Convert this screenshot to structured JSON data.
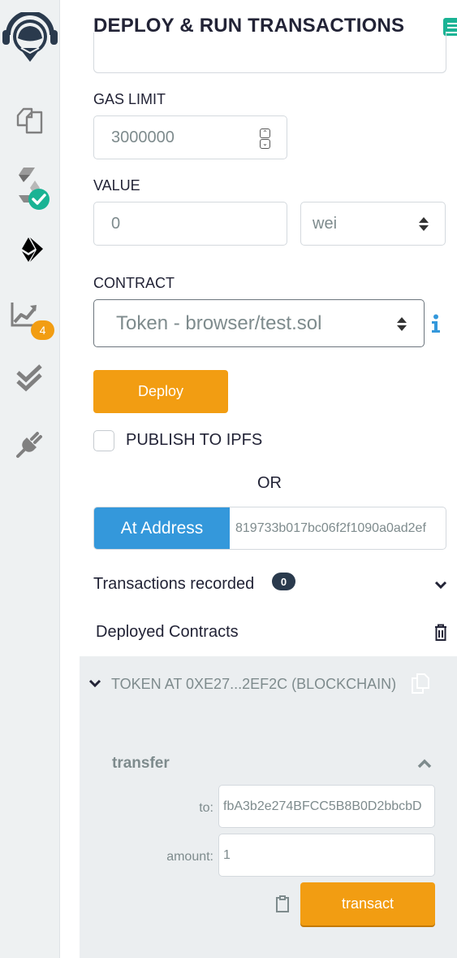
{
  "sidebar": {
    "items": [
      {
        "name": "home-logo",
        "icon": "remix-logo"
      },
      {
        "name": "file-explorer",
        "icon": "files-icon"
      },
      {
        "name": "solidity-compiler",
        "icon": "solidity-icon",
        "status": "check"
      },
      {
        "name": "deploy-run",
        "icon": "ethereum-icon",
        "active": true
      },
      {
        "name": "analysis",
        "icon": "chart-icon",
        "badge": "4"
      },
      {
        "name": "testing",
        "icon": "double-check-icon"
      },
      {
        "name": "plugin-manager",
        "icon": "plug-icon"
      }
    ],
    "colors": {
      "badge_orange": "#f29d12",
      "check_green": "#1ab394"
    }
  },
  "header": {
    "title": "DEPLOY & RUN TRANSACTIONS",
    "doc_icon": "documentation-icon"
  },
  "form": {
    "gas_limit_label": "GAS LIMIT",
    "gas_limit_value": "3000000",
    "value_label": "VALUE",
    "value_amount": "0",
    "value_unit": "wei",
    "contract_label": "CONTRACT",
    "contract_selected": "Token - browser/test.sol",
    "deploy_label": "Deploy",
    "publish_ipfs_label": "PUBLISH TO IPFS",
    "publish_ipfs_checked": false,
    "or_label": "OR",
    "at_address_label": "At Address",
    "at_address_value": "819733b017bc06f2f1090a0ad2ef"
  },
  "transactions": {
    "label": "Transactions recorded",
    "count": "0"
  },
  "deployed": {
    "title": "Deployed Contracts",
    "instances": [
      {
        "title": "TOKEN AT 0XE27...2EF2C (BLOCKCHAIN)",
        "function": {
          "name": "transfer",
          "params": [
            {
              "label": "to:",
              "value": "fbA3b2e274BFCC5B8B0D2bbcbD"
            },
            {
              "label": "amount:",
              "value": "1"
            }
          ],
          "action_label": "transact"
        }
      }
    ]
  },
  "colors": {
    "accent_orange": "#f29d12",
    "accent_blue": "#3498db",
    "info_blue": "#3498db",
    "text_dark": "#222336",
    "text_muted": "#7e8b8d"
  }
}
